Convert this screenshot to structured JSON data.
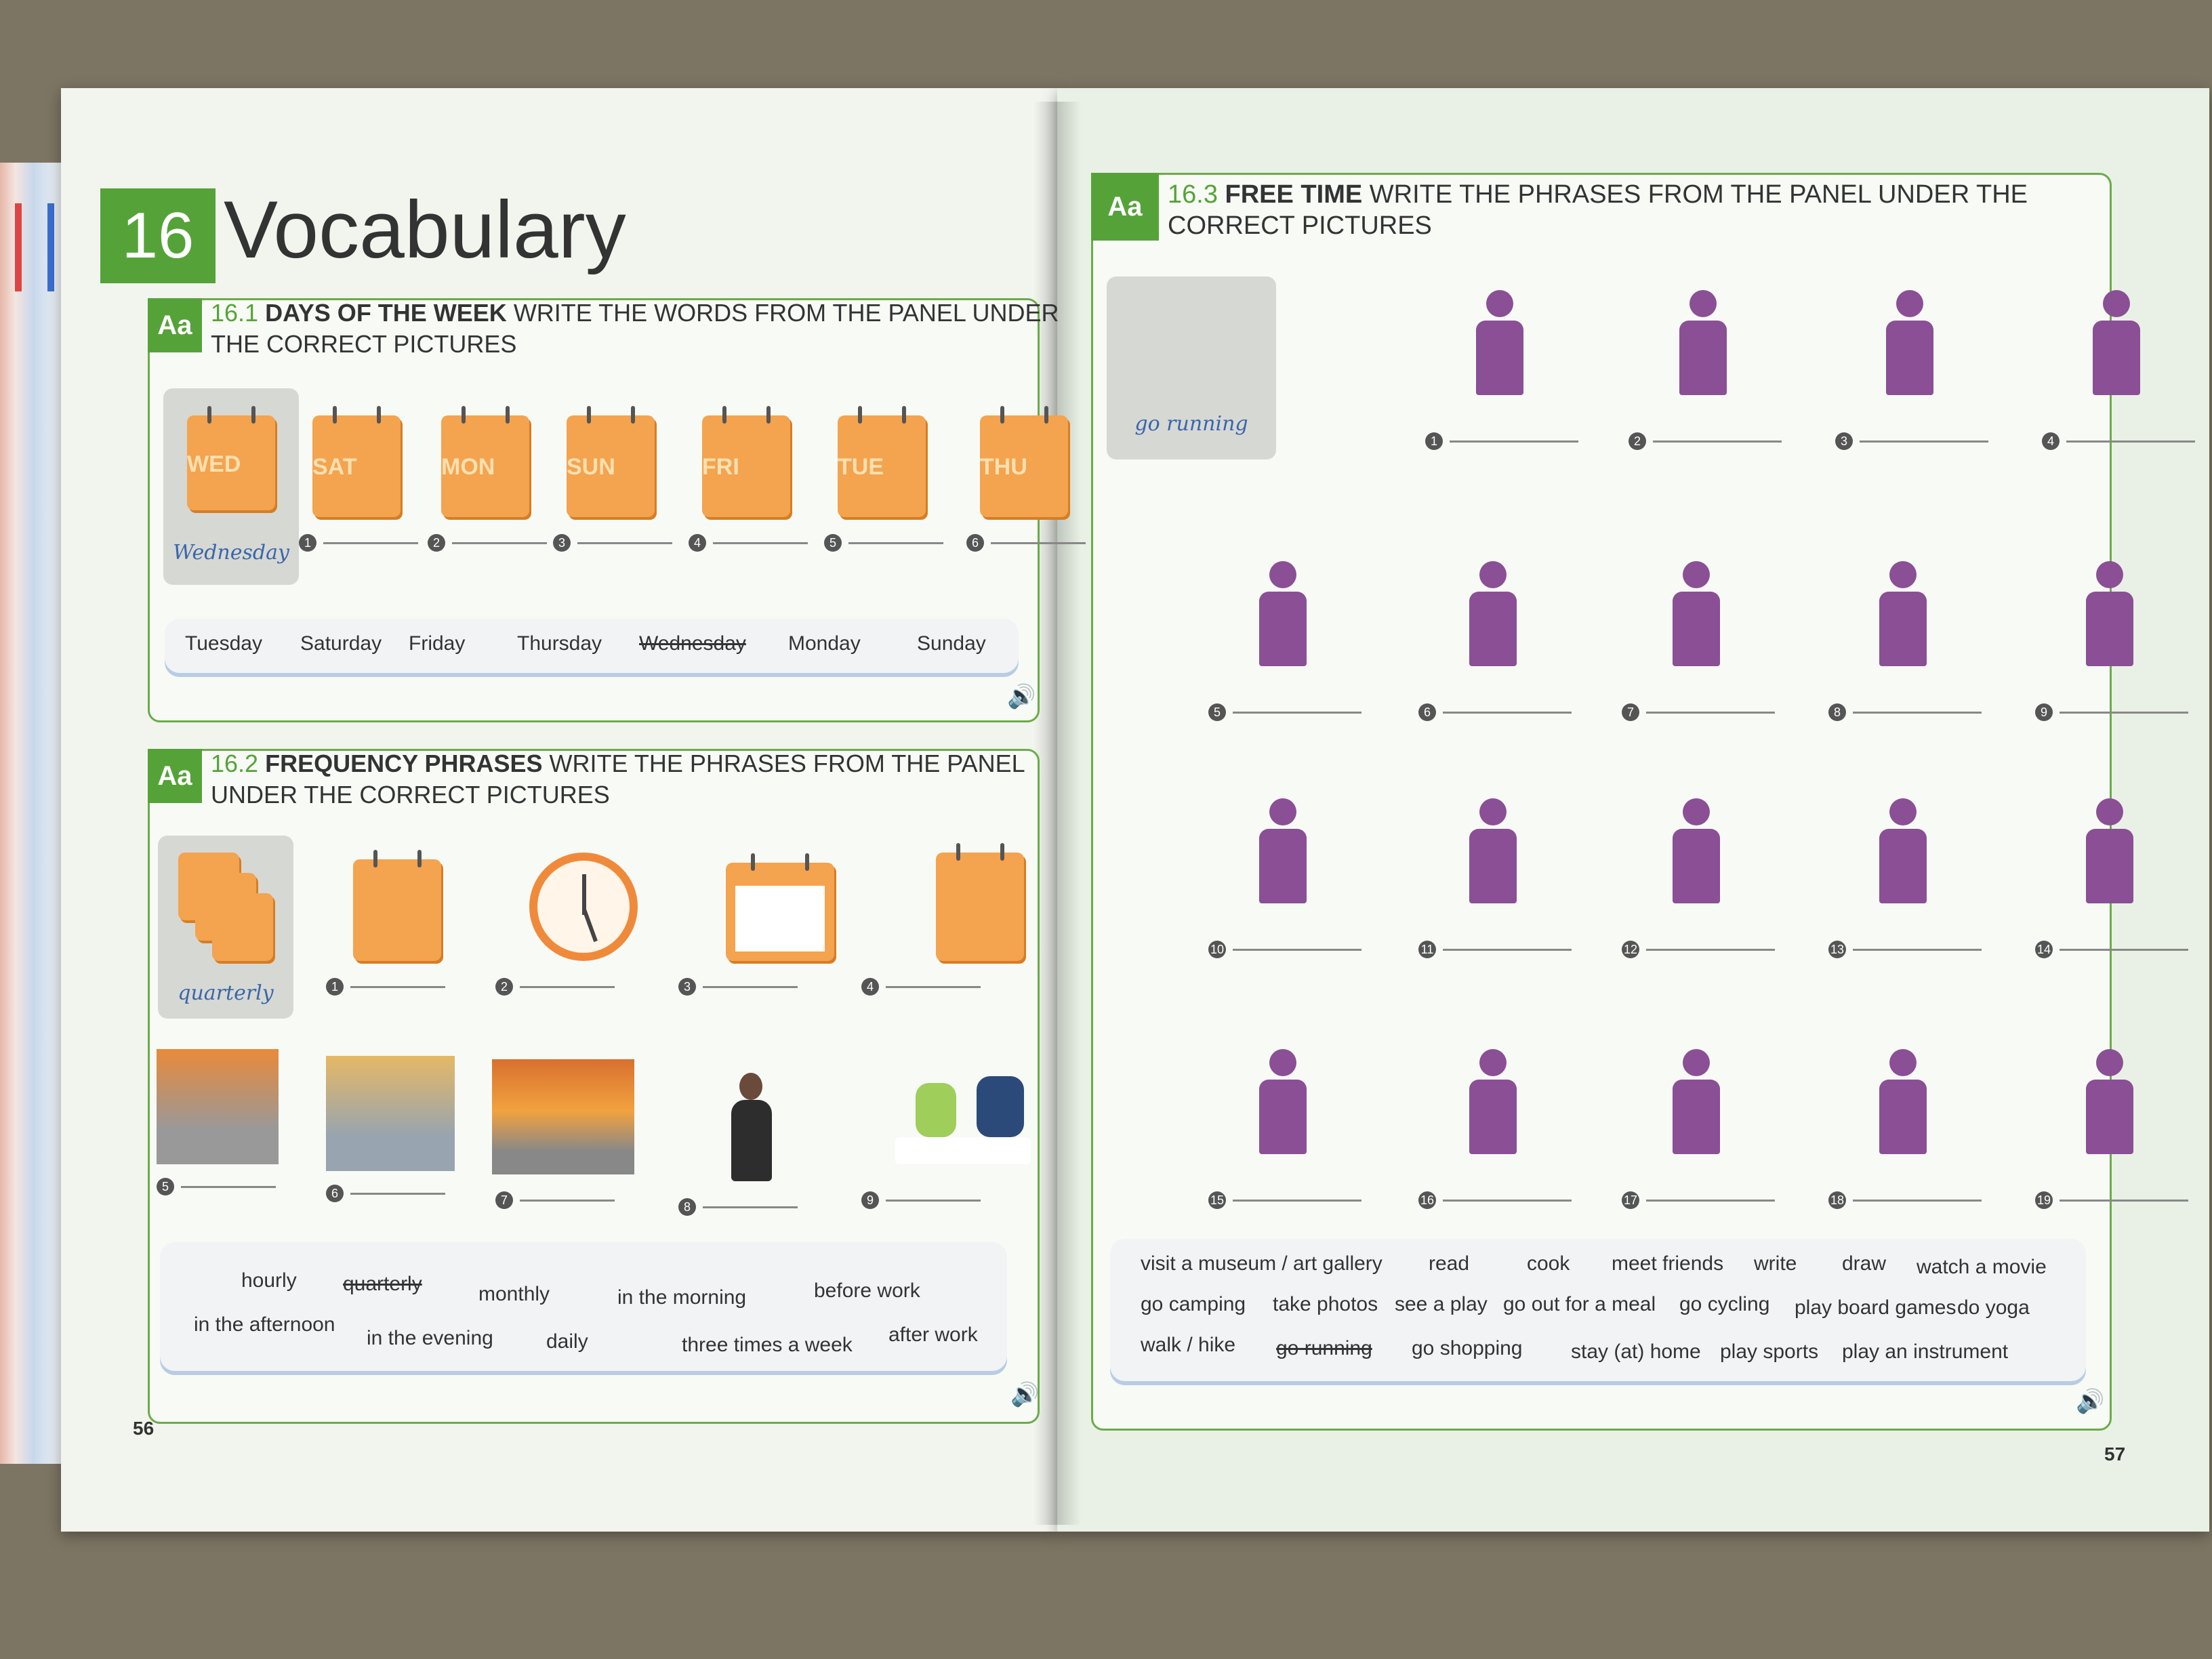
{
  "chapter": {
    "number": "16",
    "title": "Vocabulary"
  },
  "sec1": {
    "tag": "Aa",
    "num": "16.1",
    "title": "DAYS OF THE WEEK",
    "instruction": "WRITE THE WORDS FROM THE PANEL UNDER THE CORRECT PICTURES",
    "example": {
      "cal": "WED",
      "answer": "Wednesday"
    },
    "cals": [
      "SAT",
      "MON",
      "SUN",
      "FRI",
      "TUE",
      "THU"
    ],
    "nums": [
      "1",
      "2",
      "3",
      "4",
      "5",
      "6"
    ],
    "panel": [
      "Tuesday",
      "Saturday",
      "Friday",
      "Thursday",
      "Wednesday",
      "Monday",
      "Sunday"
    ]
  },
  "sec2": {
    "tag": "Aa",
    "num": "16.2",
    "title": "FREQUENCY PHRASES",
    "instruction": "WRITE THE PHRASES FROM THE PANEL UNDER THE CORRECT PICTURES",
    "example": {
      "answer": "quarterly"
    },
    "nums": [
      "1",
      "2",
      "3",
      "4",
      "5",
      "6",
      "7",
      "8",
      "9"
    ],
    "panel": [
      "hourly",
      "quarterly",
      "monthly",
      "in the morning",
      "before work",
      "in the afternoon",
      "in the evening",
      "daily",
      "three times a week",
      "after work"
    ]
  },
  "sec3": {
    "tag": "Aa",
    "num": "16.3",
    "title": "FREE TIME",
    "instruction": "WRITE THE PHRASES FROM THE PANEL UNDER THE CORRECT PICTURES",
    "example": {
      "answer": "go running"
    },
    "nums": [
      "1",
      "2",
      "3",
      "4",
      "5",
      "6",
      "7",
      "8",
      "9",
      "10",
      "11",
      "12",
      "13",
      "14",
      "15",
      "16",
      "17",
      "18",
      "19"
    ],
    "panel": [
      "visit a museum / art gallery",
      "read",
      "cook",
      "meet friends",
      "write",
      "draw",
      "watch a movie",
      "go camping",
      "take photos",
      "see a play",
      "go out for a meal",
      "go cycling",
      "play board games",
      "do yoga",
      "walk / hike",
      "go running",
      "go shopping",
      "stay (at) home",
      "play sports",
      "play an instrument"
    ]
  },
  "page_numbers": {
    "left": "56",
    "right": "57"
  },
  "colors": {
    "green": "#55a338",
    "orange": "#f4a34f",
    "purple": "#8a4f95",
    "handwriting": "#3a66a9"
  }
}
